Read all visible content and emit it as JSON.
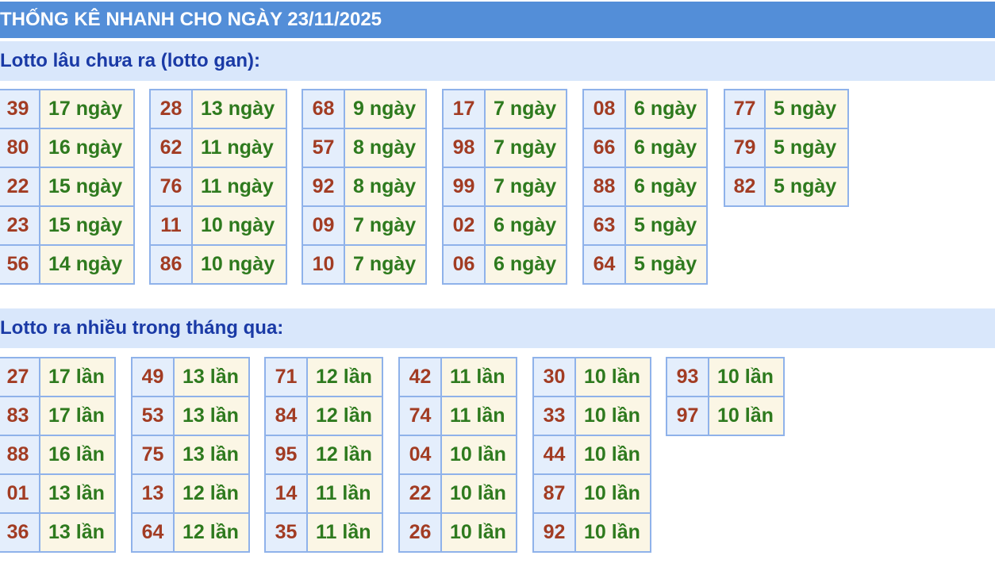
{
  "title": "THỐNG KÊ NHANH CHO NGÀY 23/11/2025",
  "gan": {
    "heading": "Lotto lâu chưa ra (lotto gan):",
    "columns": [
      [
        {
          "n": "39",
          "v": "17 ngày"
        },
        {
          "n": "80",
          "v": "16 ngày"
        },
        {
          "n": "22",
          "v": "15 ngày"
        },
        {
          "n": "23",
          "v": "15 ngày"
        },
        {
          "n": "56",
          "v": "14 ngày"
        }
      ],
      [
        {
          "n": "28",
          "v": "13 ngày"
        },
        {
          "n": "62",
          "v": "11 ngày"
        },
        {
          "n": "76",
          "v": "11 ngày"
        },
        {
          "n": "11",
          "v": "10 ngày"
        },
        {
          "n": "86",
          "v": "10 ngày"
        }
      ],
      [
        {
          "n": "68",
          "v": "9 ngày"
        },
        {
          "n": "57",
          "v": "8 ngày"
        },
        {
          "n": "92",
          "v": "8 ngày"
        },
        {
          "n": "09",
          "v": "7 ngày"
        },
        {
          "n": "10",
          "v": "7 ngày"
        }
      ],
      [
        {
          "n": "17",
          "v": "7 ngày"
        },
        {
          "n": "98",
          "v": "7 ngày"
        },
        {
          "n": "99",
          "v": "7 ngày"
        },
        {
          "n": "02",
          "v": "6 ngày"
        },
        {
          "n": "06",
          "v": "6 ngày"
        }
      ],
      [
        {
          "n": "08",
          "v": "6 ngày"
        },
        {
          "n": "66",
          "v": "6 ngày"
        },
        {
          "n": "88",
          "v": "6 ngày"
        },
        {
          "n": "63",
          "v": "5 ngày"
        },
        {
          "n": "64",
          "v": "5 ngày"
        }
      ],
      [
        {
          "n": "77",
          "v": "5 ngày"
        },
        {
          "n": "79",
          "v": "5 ngày"
        },
        {
          "n": "82",
          "v": "5 ngày"
        }
      ]
    ]
  },
  "frequent": {
    "heading": "Lotto ra nhiều trong tháng qua:",
    "columns": [
      [
        {
          "n": "27",
          "v": "17 lần"
        },
        {
          "n": "83",
          "v": "17 lần"
        },
        {
          "n": "88",
          "v": "16 lần"
        },
        {
          "n": "01",
          "v": "13 lần"
        },
        {
          "n": "36",
          "v": "13 lần"
        }
      ],
      [
        {
          "n": "49",
          "v": "13 lần"
        },
        {
          "n": "53",
          "v": "13 lần"
        },
        {
          "n": "75",
          "v": "13 lần"
        },
        {
          "n": "13",
          "v": "12 lần"
        },
        {
          "n": "64",
          "v": "12 lần"
        }
      ],
      [
        {
          "n": "71",
          "v": "12 lần"
        },
        {
          "n": "84",
          "v": "12 lần"
        },
        {
          "n": "95",
          "v": "12 lần"
        },
        {
          "n": "14",
          "v": "11 lần"
        },
        {
          "n": "35",
          "v": "11 lần"
        }
      ],
      [
        {
          "n": "42",
          "v": "11 lần"
        },
        {
          "n": "74",
          "v": "11 lần"
        },
        {
          "n": "04",
          "v": "10 lần"
        },
        {
          "n": "22",
          "v": "10 lần"
        },
        {
          "n": "26",
          "v": "10 lần"
        }
      ],
      [
        {
          "n": "30",
          "v": "10 lần"
        },
        {
          "n": "33",
          "v": "10 lần"
        },
        {
          "n": "44",
          "v": "10 lần"
        },
        {
          "n": "87",
          "v": "10 lần"
        },
        {
          "n": "92",
          "v": "10 lần"
        }
      ],
      [
        {
          "n": "93",
          "v": "10 lần"
        },
        {
          "n": "97",
          "v": "10 lần"
        }
      ]
    ]
  }
}
